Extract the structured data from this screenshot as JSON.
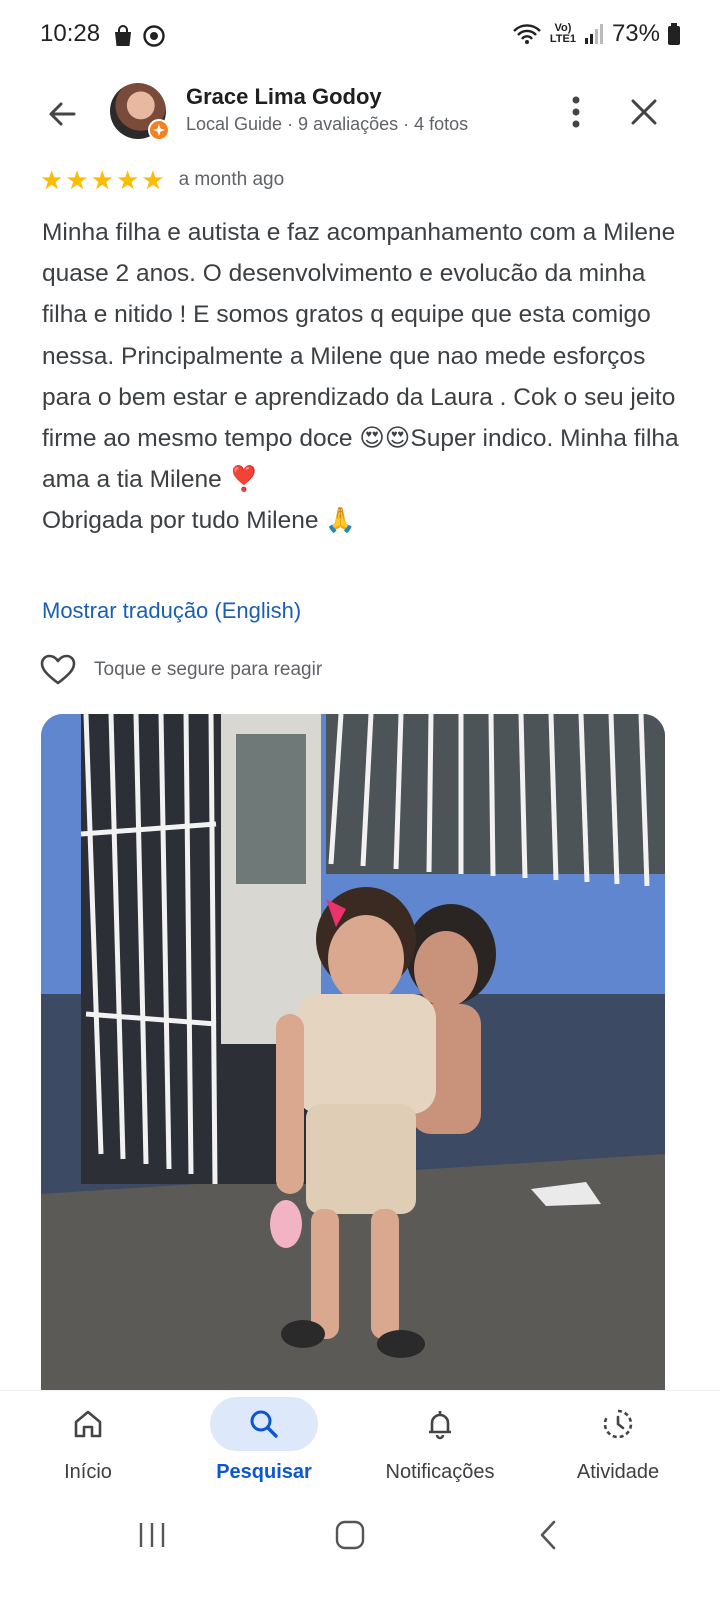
{
  "status_bar": {
    "time": "10:28",
    "battery": "73%",
    "network_label": "LTE1"
  },
  "header": {
    "user_name": "Grace Lima Godoy",
    "user_meta": "Local Guide · 9 avaliações · 4 fotos"
  },
  "review": {
    "stars": 5,
    "time_ago": "a month ago",
    "text": "Minha filha e autista e faz acompanhamento com a Milene quase 2 anos. O desenvolvimento e evolucão da minha filha e nitido ! E somos gratos q equipe que esta comigo nessa. Principalmente a Milene que nao mede esforços para o bem estar e aprendizado da Laura . Cok o seu jeito firme ao mesmo tempo doce 😍😍Super indico. Minha filha ama a tia Milene ❣️\nObrigada por tudo Milene 🙏",
    "translate_link": "Mostrar tradução (English)",
    "react_label": "Toque e segure para reagir"
  },
  "bottom_nav": [
    {
      "label": "Início",
      "icon": "home-icon",
      "active": false
    },
    {
      "label": "Pesquisar",
      "icon": "search-icon",
      "active": true
    },
    {
      "label": "Notificações",
      "icon": "bell-icon",
      "active": false
    },
    {
      "label": "Atividade",
      "icon": "activity-icon",
      "active": false
    }
  ],
  "colors": {
    "star": "#fbbc04",
    "link": "#1a5fb4",
    "active_nav": "#0b57d0",
    "active_pill": "#dde8fb"
  }
}
